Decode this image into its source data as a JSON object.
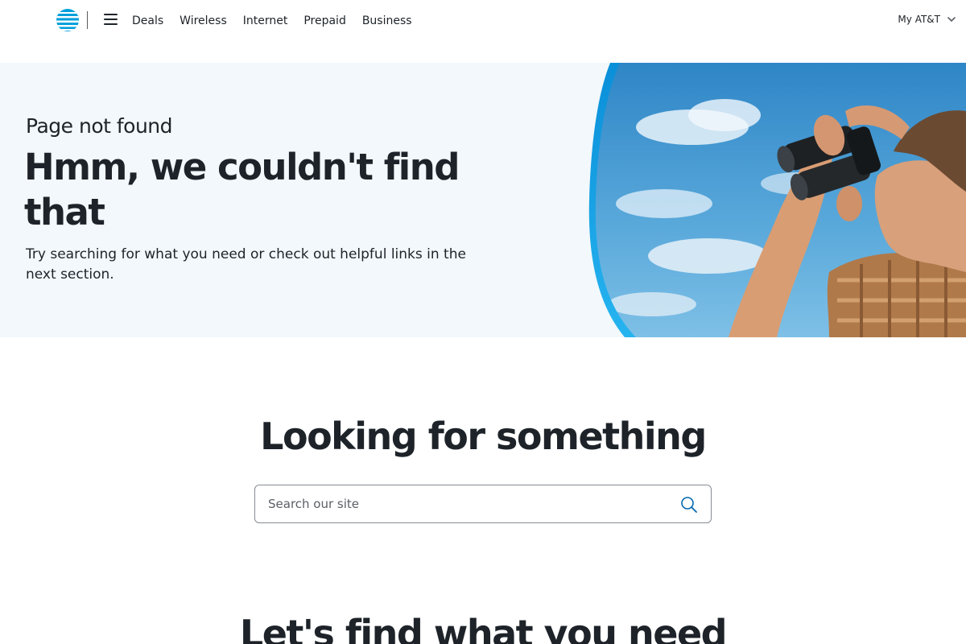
{
  "header": {
    "logo_name": "att-globe-logo",
    "menu_icon": "hamburger-menu-icon",
    "nav": [
      {
        "label": "Deals"
      },
      {
        "label": "Wireless"
      },
      {
        "label": "Internet"
      },
      {
        "label": "Prepaid"
      },
      {
        "label": "Business"
      }
    ],
    "account": {
      "label": "My AT&T",
      "icon": "chevron-down-icon"
    }
  },
  "hero": {
    "eyebrow": "Page not found",
    "title": "Hmm, we couldn't find that",
    "description": "Try searching for what you need or check out helpful links in the next section.",
    "image": "woman-with-binoculars-photo"
  },
  "search": {
    "title": "Looking for something",
    "placeholder": "Search our site",
    "value": "",
    "icon": "search-icon"
  },
  "links_section": {
    "title": "Let's find what you need"
  },
  "colors": {
    "brand_blue": "#009fdb",
    "text": "#1d2329",
    "hero_bg": "#f2f8fb",
    "sky": "#4a9fd4"
  }
}
